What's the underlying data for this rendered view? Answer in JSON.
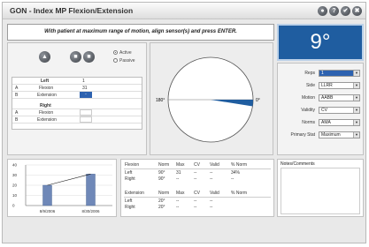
{
  "window": {
    "title": "GON - Index MP Flexion/Extension"
  },
  "titlebar_buttons": [
    "●",
    "?",
    "✔",
    "✖"
  ],
  "instruction": "With patient at maximum range of motion, align sensor(s) and press ENTER.",
  "reading": {
    "value": "9°"
  },
  "controls": {
    "buttons": [
      "▲",
      "■",
      "■"
    ],
    "radios": [
      {
        "label": "Active",
        "selected": true
      },
      {
        "label": "Passive",
        "selected": false
      }
    ]
  },
  "left_table": {
    "header": "Left",
    "col": "1",
    "rows": [
      {
        "key": "A",
        "label": "Flexion",
        "value": "31"
      },
      {
        "key": "B",
        "label": "Extension",
        "value": "-"
      }
    ]
  },
  "right_table": {
    "header": "Right",
    "rows": [
      {
        "key": "A",
        "label": "Flexion",
        "value": ""
      },
      {
        "key": "B",
        "label": "Extension",
        "value": ""
      }
    ]
  },
  "gauge": {
    "left_label": "180°",
    "right_label": "0°",
    "angle_deg": 9
  },
  "settings": [
    {
      "label": "Reps",
      "value": "1",
      "highlight": true
    },
    {
      "label": "Side",
      "value": "LLRR",
      "highlight": false
    },
    {
      "label": "Motion",
      "value": "AABB",
      "highlight": false
    },
    {
      "label": "Validity",
      "value": "CV",
      "highlight": false
    },
    {
      "label": "Norms",
      "value": "AMA",
      "highlight": false
    },
    {
      "label": "Primary Stat",
      "value": "Maximum",
      "highlight": false
    }
  ],
  "chart_data": {
    "type": "bar",
    "categories": [
      "8/9/2006",
      "8/30/2006"
    ],
    "values": [
      20,
      31
    ],
    "ylim": [
      0,
      40
    ],
    "yticks": [
      "40",
      "30",
      "20",
      "10",
      "0"
    ]
  },
  "summary": {
    "flexion": {
      "headers": [
        "Flexion",
        "Norm",
        "Max",
        "CV",
        "Valid",
        "% Norm"
      ],
      "rows": [
        [
          "Left",
          "90°",
          "31",
          "--",
          "--",
          "34%"
        ],
        [
          "Right",
          "90°",
          "--",
          "--",
          "--",
          "--"
        ]
      ]
    },
    "extension": {
      "headers": [
        "Extension",
        "Norm",
        "Max",
        "CV",
        "Valid",
        "% Norm"
      ],
      "rows": [
        [
          "Left",
          "20°",
          "--",
          "--",
          "--",
          ""
        ],
        [
          "Right",
          "20°",
          "--",
          "--",
          "--",
          ""
        ]
      ]
    }
  },
  "notes": {
    "label": "Notes/Comments"
  }
}
